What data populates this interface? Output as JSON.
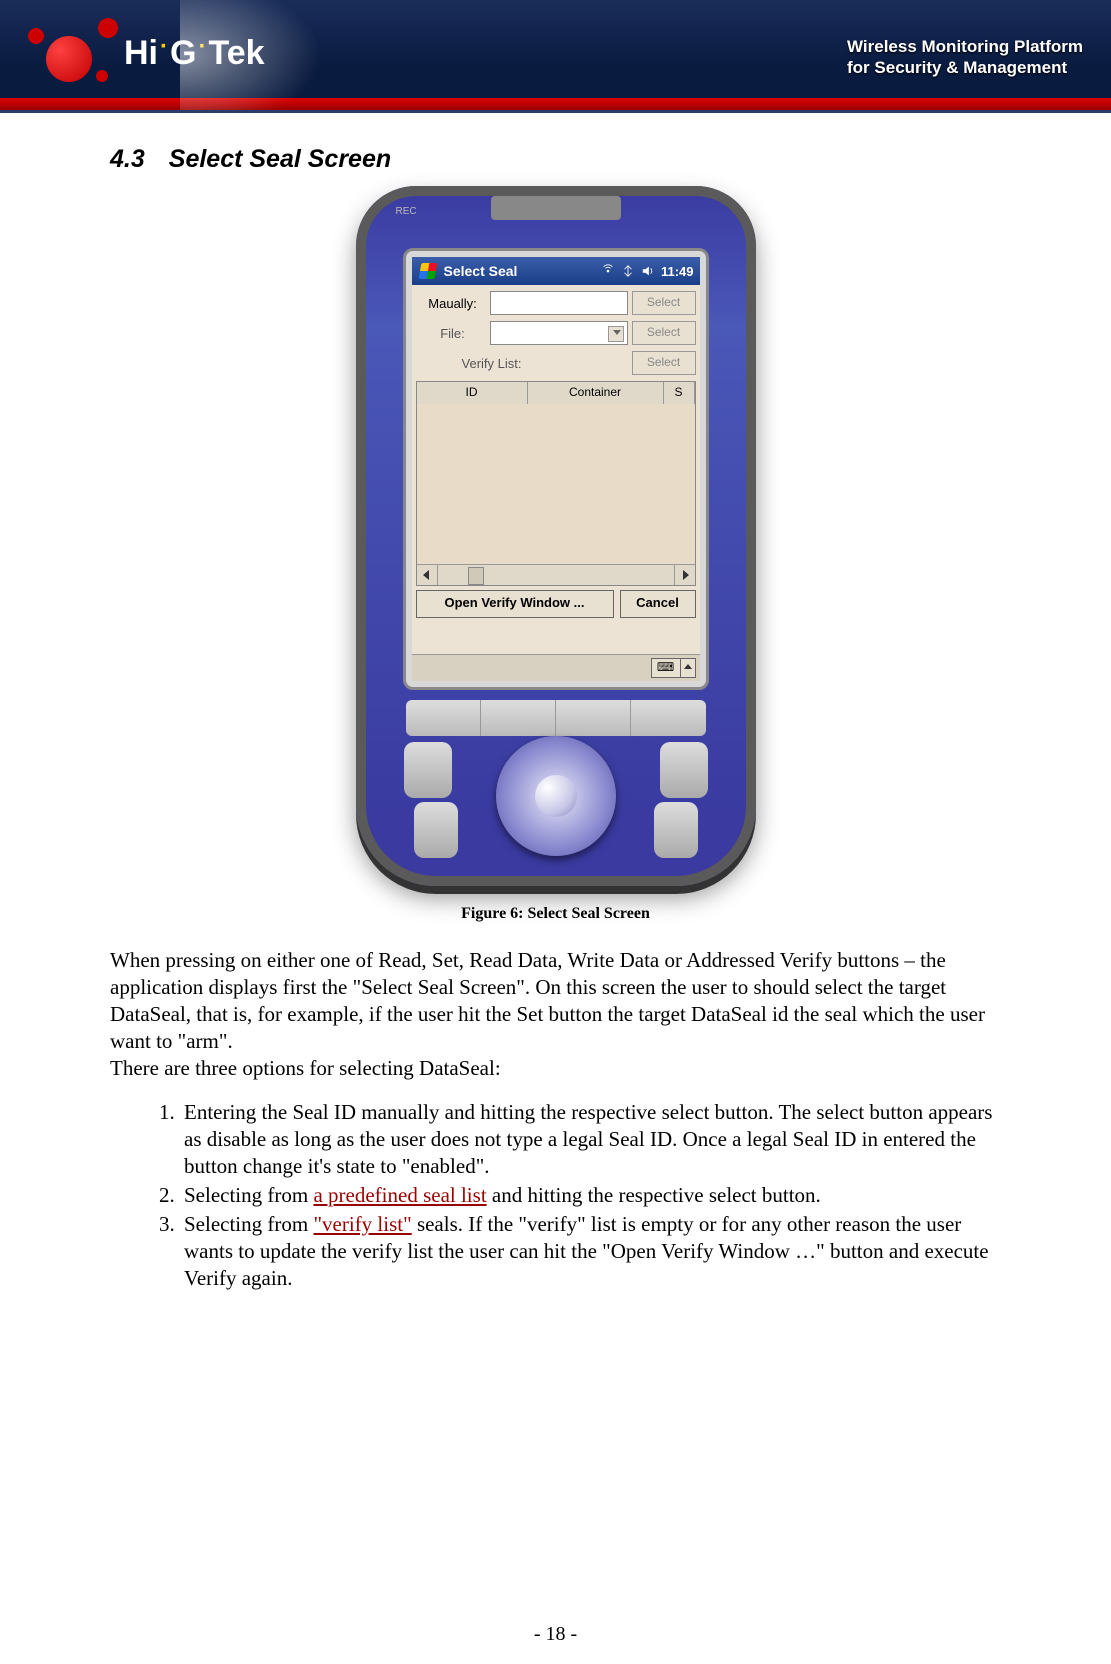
{
  "banner": {
    "logo_text_parts": [
      "Hi",
      "G",
      "Tek"
    ],
    "tagline_line1": "Wireless Monitoring Platform",
    "tagline_line2": "for Security & Management"
  },
  "section": {
    "number": "4.3",
    "title": "Select Seal Screen"
  },
  "device": {
    "rec_label": "REC",
    "titlebar": {
      "title": "Select Seal",
      "time": "11:49"
    },
    "form": {
      "manually_label": "Maually:",
      "file_label": "File:",
      "verify_label": "Verify List:",
      "select_label": "Select"
    },
    "table": {
      "col_id": "ID",
      "col_container": "Container",
      "col_s": "S"
    },
    "buttons": {
      "open_verify": "Open Verify Window ...",
      "cancel": "Cancel"
    }
  },
  "caption": "Figure 6:  Select Seal Screen",
  "paragraph": "When pressing on either one of Read, Set, Read Data, Write Data or Addressed Verify buttons – the application displays first the \"Select Seal Screen\".  On this screen the user to should select the target DataSeal, that is, for example, if the user hit the Set button the target DataSeal id the seal which the user want to \"arm\".\nThere are three options for selecting DataSeal:",
  "list": {
    "item1": "Entering the Seal ID manually and hitting the respective select button. The select button appears as disable as long as the user does not type a legal Seal ID. Once a legal Seal ID in entered the button change it's state to \"enabled\".",
    "item2_pre": "Selecting from ",
    "item2_link": "a predefined seal list",
    "item2_post": " and hitting the respective select button.",
    "item3_pre": "Selecting from ",
    "item3_link": "\"verify list\"",
    "item3_post": " seals. If the \"verify\" list is empty or for any other reason the user wants to update the verify list the user can hit the \"Open Verify Window …\" button and execute Verify again."
  },
  "footer": "- 18 -"
}
